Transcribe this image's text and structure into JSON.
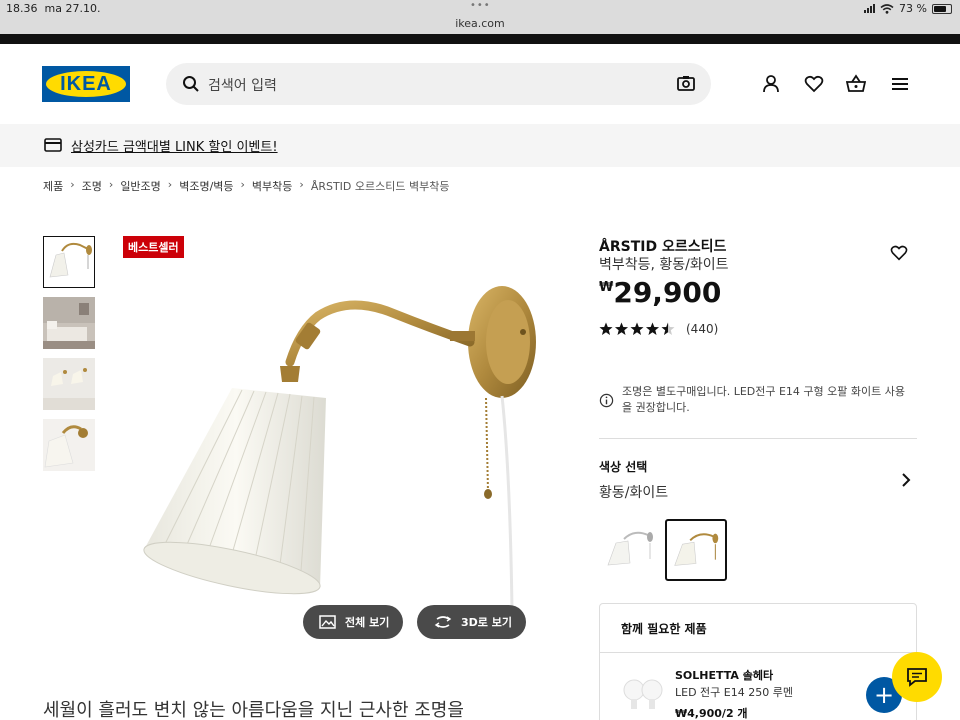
{
  "status_bar": {
    "time": "18.36",
    "date": "ma 27.10.",
    "url": "ikea.com",
    "battery": "73 %",
    "battery_level": 0.73
  },
  "header": {
    "logo_text": "IKEA",
    "search_placeholder": "검색어 입력",
    "icons": [
      "search-icon",
      "camera-icon",
      "user-icon",
      "heart-icon",
      "basket-icon",
      "menu-icon"
    ]
  },
  "promo": {
    "text": "삼성카드 금액대별 LINK 할인 이벤트!",
    "icon": "credit-card-icon"
  },
  "breadcrumb": [
    "제품",
    "조명",
    "일반조명",
    "벽조명/벽등",
    "벽부착등",
    "ÅRSTID 오르스티드 벽부착등"
  ],
  "gallery": {
    "badge": "베스트셀러",
    "thumbnail_count": 4,
    "fullscreen_label": "전체 보기",
    "view3d_label": "3D로 보기"
  },
  "tagline": "세월이 흘러도 변치 않는 아름다움을 지닌 근사한 조명을",
  "product": {
    "name": "ÅRSTID 오르스티드",
    "description": "벽부착등, 황동/화이트",
    "currency": "₩",
    "price": "29,900",
    "rating": 4.5,
    "review_count": "(440)",
    "info_note": "조명은 별도구매입니다. LED전구 E14 구형 오팔 화이트 사용을 권장합니다.",
    "color_label": "색상 선택",
    "color_value": "황동/화이트"
  },
  "together": {
    "title": "함께 필요한 제품",
    "item_name": "SOLHETTA 솔헤타",
    "item_desc": "LED 전구 E14 250 루멘",
    "item_price": "₩4,900/2 개"
  },
  "colors": {
    "brand_blue": "#0058a3",
    "brand_yellow": "#ffdb00",
    "badge_red": "#cc0008"
  }
}
